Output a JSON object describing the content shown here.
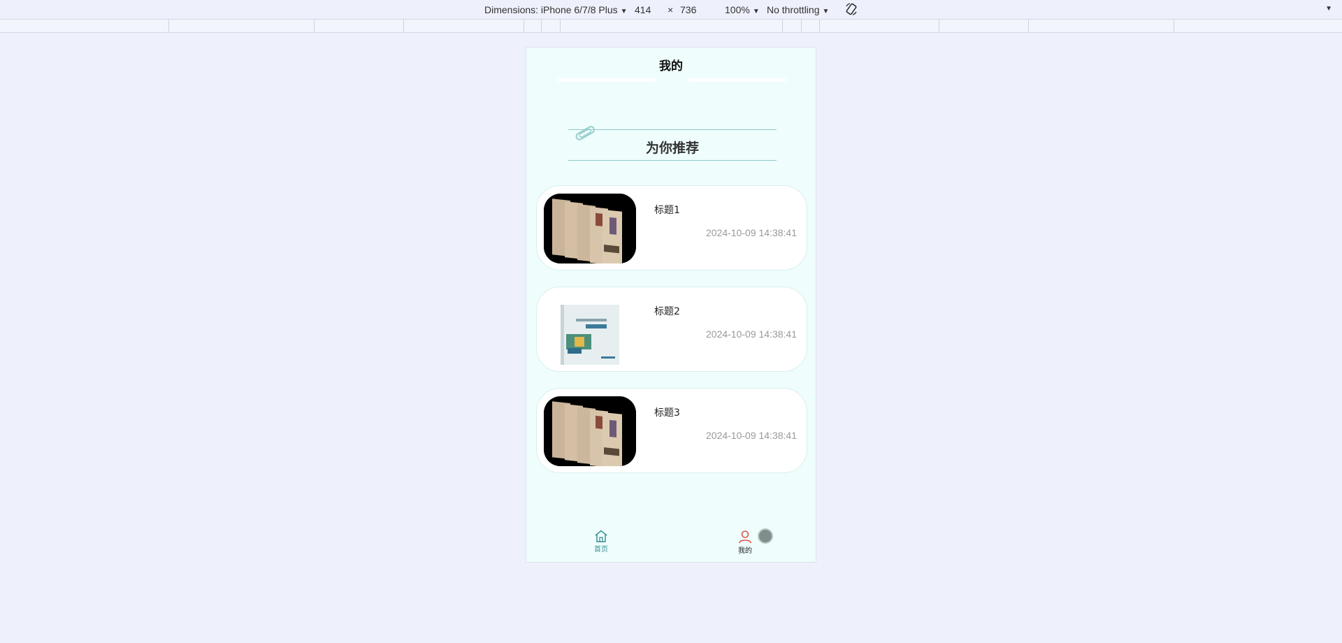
{
  "devtools": {
    "dimensions_label": "Dimensions: iPhone 6/7/8 Plus",
    "width": "414",
    "times": "×",
    "height": "736",
    "zoom": "100%",
    "throttling": "No throttling"
  },
  "page": {
    "title": "我的"
  },
  "section": {
    "title": "为你推荐"
  },
  "items": [
    {
      "title": "标题1",
      "time": "2024-10-09 14:38:41",
      "image": "book-stack"
    },
    {
      "title": "标题2",
      "time": "2024-10-09 14:38:41",
      "image": "book-cover"
    },
    {
      "title": "标题3",
      "time": "2024-10-09 14:38:41",
      "image": "book-stack"
    }
  ],
  "tabbar": {
    "home": {
      "label": "首页",
      "icon": "home-icon",
      "color": "#3a8f95"
    },
    "mine": {
      "label": "我的",
      "icon": "user-icon",
      "color": "#e0534a"
    }
  }
}
